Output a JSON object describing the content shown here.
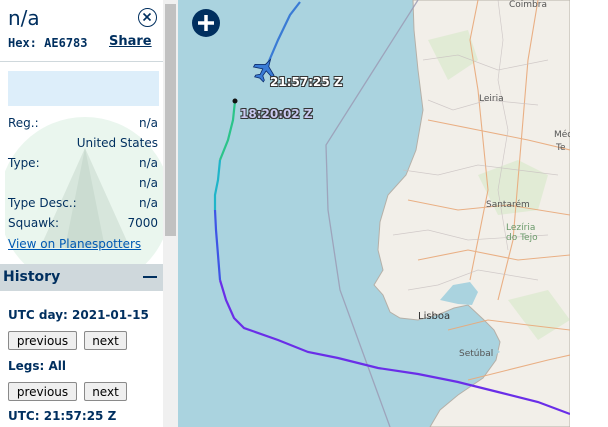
{
  "aircraft": {
    "callsign": "n/a",
    "hex_label": "Hex:",
    "hex": "AE6783",
    "share_label": "Share"
  },
  "details": {
    "reg_label": "Reg.:",
    "reg_value": "n/a",
    "country": "United States",
    "type_label": "Type:",
    "type_value": "n/a",
    "type_value2": "n/a",
    "type_desc_label": "Type Desc.:",
    "type_desc_value": "n/a",
    "squawk_label": "Squawk:",
    "squawk_value": "7000",
    "planespotters_link": "View on Planespotters"
  },
  "history": {
    "title": "History",
    "utc_day_label": "UTC day: 2021-01-15",
    "previous_label": "previous",
    "next_label": "next",
    "legs_label": "Legs: All",
    "utc_time_label": "UTC: 21:57:25 Z"
  },
  "map": {
    "aircraft_time_label": "21:57:25 Z",
    "track_start_label": "18:20:02 Z",
    "places": {
      "leiria": "Leiria",
      "santarem": "Santarém",
      "leziria": "Lezíria do Tejo",
      "lisboa": "Lisboa",
      "setubal": "Setúbal",
      "coimbra": "Coimbra",
      "medio_1": "Méd",
      "medio_2": "Te"
    },
    "colors": {
      "sea": "#aad3df",
      "land": "#f2efe9",
      "track_purple": "#6a2ee8",
      "track_blue": "#2a6fe6",
      "track_cyan": "#1fb5c9",
      "track_green": "#2bc48a",
      "aircraft": "#3a7bd5"
    }
  }
}
